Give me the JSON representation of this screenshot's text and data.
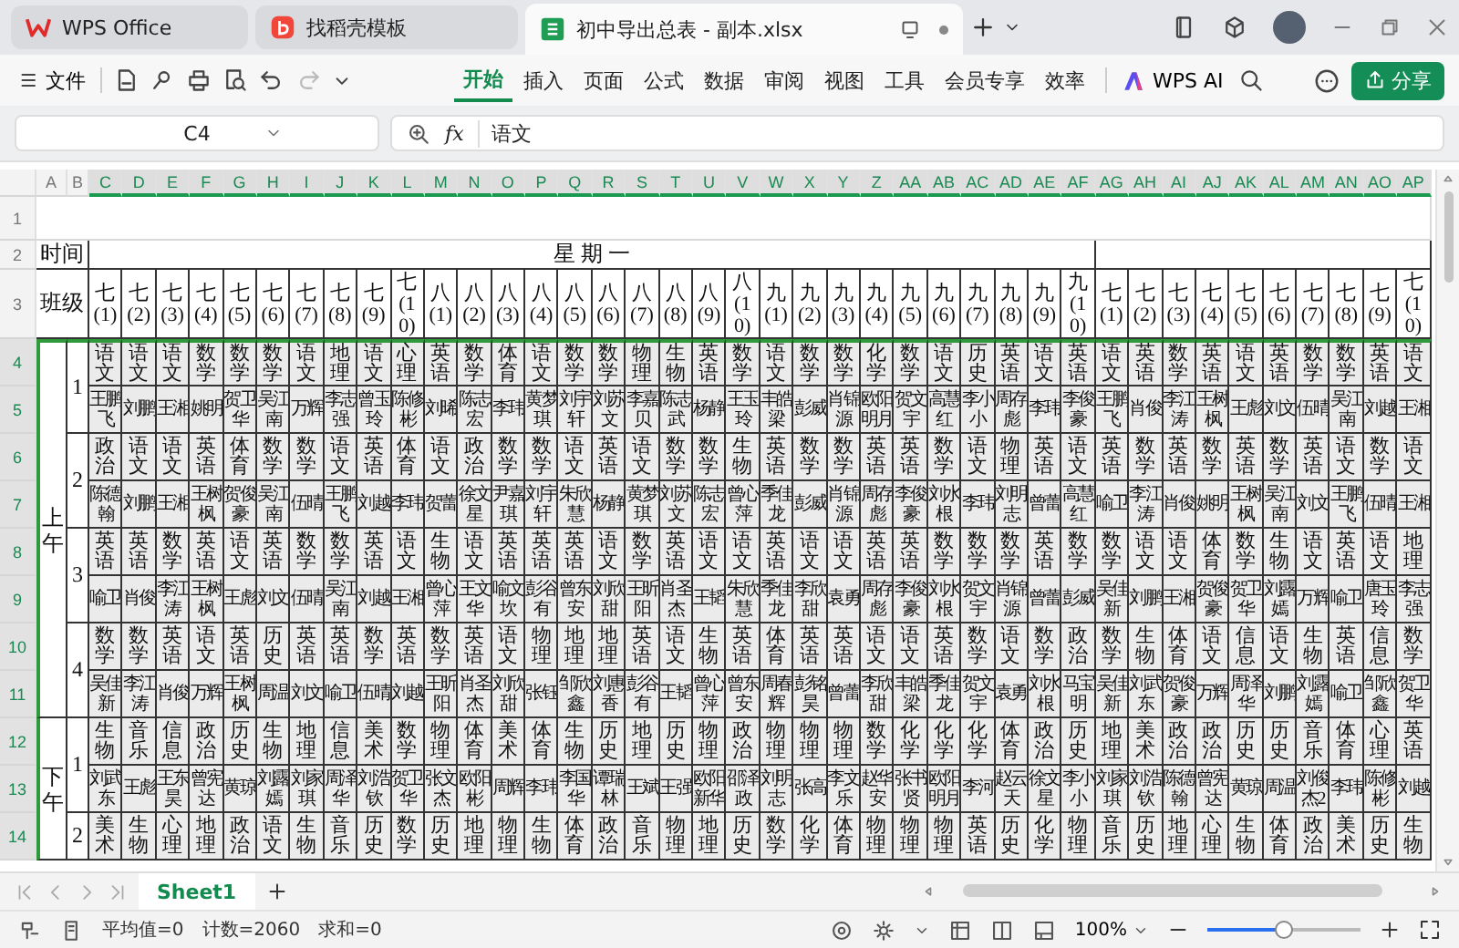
{
  "title_bar": {
    "tabs": [
      {
        "label": "WPS Office",
        "kind": "home",
        "selected": false
      },
      {
        "label": "找稻壳模板",
        "kind": "template",
        "selected": false
      },
      {
        "label": "初中导出总表 - 副本.xlsx",
        "kind": "document",
        "selected": true
      }
    ]
  },
  "toolbar": {
    "file_menu": "文件",
    "ribbon_tabs": [
      {
        "label": "开始",
        "selected": true
      },
      {
        "label": "插入",
        "selected": false
      },
      {
        "label": "页面",
        "selected": false
      },
      {
        "label": "公式",
        "selected": false
      },
      {
        "label": "数据",
        "selected": false
      },
      {
        "label": "审阅",
        "selected": false
      },
      {
        "label": "视图",
        "selected": false
      },
      {
        "label": "工具",
        "selected": false
      },
      {
        "label": "会员专享",
        "selected": false
      },
      {
        "label": "效率",
        "selected": false
      }
    ],
    "ai_label": "WPS AI",
    "share_label": "分享"
  },
  "formula_bar": {
    "cell_reference": "C4",
    "function_label": "fx",
    "value": "语文"
  },
  "sheet": {
    "column_headers": [
      "A",
      "B",
      "C",
      "D",
      "E",
      "F",
      "G",
      "H",
      "I",
      "J",
      "K",
      "L",
      "M",
      "N",
      "O",
      "P",
      "Q",
      "R",
      "S",
      "T",
      "U",
      "V",
      "W",
      "X",
      "Y",
      "Z",
      "AA",
      "AB",
      "AC",
      "AD",
      "AE",
      "AF",
      "AG",
      "AH",
      "AI",
      "AJ",
      "AK",
      "AL",
      "AM",
      "AN",
      "AO",
      "AP"
    ],
    "row_numbers": [
      "1",
      "2",
      "3",
      "4",
      "5",
      "6",
      "7",
      "8",
      "9",
      "10",
      "11",
      "12",
      "13",
      "14"
    ],
    "time_label": "时间",
    "day_label": "星 期 一",
    "class_label": "班级",
    "classes": [
      "七(1)",
      "七(2)",
      "七(3)",
      "七(4)",
      "七(5)",
      "七(6)",
      "七(7)",
      "七(8)",
      "七(9)",
      "七(10)",
      "八(1)",
      "八(2)",
      "八(3)",
      "八(4)",
      "八(5)",
      "八(6)",
      "八(7)",
      "八(8)",
      "八(9)",
      "八(10)",
      "九(1)",
      "九(2)",
      "九(3)",
      "九(4)",
      "九(5)",
      "九(6)",
      "九(7)",
      "九(8)",
      "九(9)",
      "九(10)",
      "七(1)",
      "七(2)",
      "七(3)",
      "七(4)",
      "七(5)",
      "七(6)",
      "七(7)",
      "七(8)",
      "七(9)",
      "七(10)"
    ],
    "sessions": [
      {
        "label": "上午",
        "periods": [
          {
            "label": "1",
            "subjects": [
              "语文",
              "语文",
              "语文",
              "数学",
              "数学",
              "数学",
              "语文",
              "地理",
              "语文",
              "心理",
              "英语",
              "数学",
              "体育",
              "语文",
              "数学",
              "数学",
              "物理",
              "生物",
              "英语",
              "数学",
              "语文",
              "数学",
              "数学",
              "化学",
              "数学",
              "语文",
              "历史",
              "英语",
              "语文",
              "英语",
              "语文",
              "英语",
              "数学",
              "英语",
              "语文",
              "英语",
              "数学",
              "数学",
              "英语",
              "语文"
            ],
            "teachers": [
              "王鹏飞",
              "刘鹏",
              "王湘",
              "姚明",
              "贺卫华",
              "吴江南",
              "万辉",
              "李志强",
              "曾玉玲",
              "陈修彬",
              "刘晞",
              "陈志宏",
              "李玮",
              "黄梦琪",
              "刘宇轩",
              "刘苏文",
              "李嘉贝",
              "陈志武",
              "杨静",
              "王玉玲",
              "丰皓梁",
              "彭威",
              "肖锦源",
              "欧阳明月",
              "贺文宇",
              "高慧红",
              "李小小",
              "周存彪",
              "李玮",
              "李俊豪",
              "王鹏飞",
              "肖俊",
              "李江涛",
              "王树枫",
              "王彪",
              "刘文",
              "伍晴",
              "吴江南",
              "刘越",
              "王湘"
            ]
          },
          {
            "label": "2",
            "subjects": [
              "政治",
              "语文",
              "语文",
              "英语",
              "体育",
              "数学",
              "数学",
              "语文",
              "英语",
              "体育",
              "语文",
              "政治",
              "数学",
              "数学",
              "语文",
              "英语",
              "语文",
              "数学",
              "数学",
              "生物",
              "英语",
              "数学",
              "数学",
              "英语",
              "英语",
              "数学",
              "语文",
              "物理",
              "英语",
              "语文",
              "英语",
              "数学",
              "英语",
              "数学",
              "英语",
              "数学",
              "英语",
              "语文",
              "数学",
              "语文"
            ],
            "teachers": [
              "陈德翰",
              "刘鹏",
              "王湘",
              "王树枫",
              "贺俊豪",
              "吴江南",
              "伍晴",
              "王鹏飞",
              "刘越",
              "李玮",
              "贺蕾",
              "徐文星",
              "尹嘉琪",
              "刘宇轩",
              "朱欣慧",
              "杨静",
              "黄梦琪",
              "刘苏文",
              "陈志宏",
              "曾心萍",
              "季佳龙",
              "彭威",
              "肖锦源",
              "周存彪",
              "李俊豪",
              "刘水根",
              "李玮",
              "刘明志",
              "曾蕾",
              "高慧红",
              "喻卫",
              "李江涛",
              "肖俊",
              "姚明",
              "王树枫",
              "吴江南",
              "刘文",
              "王鹏飞",
              "伍晴",
              "王湘"
            ]
          },
          {
            "label": "3",
            "subjects": [
              "英语",
              "英语",
              "数学",
              "英语",
              "语文",
              "英语",
              "数学",
              "数学",
              "英语",
              "语文",
              "生物",
              "语文",
              "英语",
              "英语",
              "英语",
              "语文",
              "数学",
              "英语",
              "语文",
              "语文",
              "英语",
              "语文",
              "语文",
              "英语",
              "英语",
              "数学",
              "数学",
              "数学",
              "英语",
              "数学",
              "数学",
              "语文",
              "语文",
              "体育",
              "数学",
              "生物",
              "语文",
              "英语",
              "语文",
              "地理"
            ],
            "teachers": [
              "喻卫",
              "肖俊",
              "李江涛",
              "王树枫",
              "王彪",
              "刘文",
              "伍晴",
              "吴江南",
              "刘越",
              "王湘",
              "曾心萍",
              "王文华",
              "喻文坎",
              "彭谷有",
              "曾东安",
              "刘欣甜",
              "王昕阳",
              "肖圣杰",
              "王韬",
              "朱欣慧",
              "季佳龙",
              "李欣甜",
              "袁勇",
              "周存彪",
              "李俊豪",
              "刘水根",
              "贺文宇",
              "肖锦源",
              "曾蕾",
              "彭威",
              "吴佳新",
              "刘鹏",
              "王湘",
              "贺俊豪",
              "贺卫华",
              "刘露嫣",
              "万辉",
              "喻卫",
              "唐玉玲",
              "李志强"
            ]
          },
          {
            "label": "4",
            "subjects": [
              "数学",
              "数学",
              "英语",
              "语文",
              "英语",
              "历史",
              "英语",
              "英语",
              "数学",
              "英语",
              "数学",
              "英语",
              "语文",
              "物理",
              "地理",
              "地理",
              "英语",
              "语文",
              "生物",
              "英语",
              "体育",
              "英语",
              "英语",
              "语文",
              "语文",
              "英语",
              "数学",
              "语文",
              "数学",
              "政治",
              "数学",
              "生物",
              "体育",
              "语文",
              "信息",
              "语文",
              "生物",
              "英语",
              "信息",
              "数学"
            ],
            "teachers": [
              "吴佳新",
              "李江涛",
              "肖俊",
              "万辉",
              "王树枫",
              "周温",
              "刘文",
              "喻卫",
              "伍晴",
              "刘越",
              "王昕阳",
              "肖圣杰",
              "刘欣甜",
              "张钰",
              "邹欣鑫",
              "刘惠香",
              "彭谷有",
              "王韬",
              "曾心萍",
              "曾东安",
              "周春辉",
              "彭铭昊",
              "曾蕾",
              "李欣甜",
              "丰皓梁",
              "季佳龙",
              "贺文宇",
              "袁勇",
              "刘水根",
              "马宝明",
              "吴佳新",
              "刘武东",
              "贺俊豪",
              "万辉",
              "周泽华",
              "刘鹏",
              "刘露嫣",
              "喻卫",
              "邹欣鑫",
              "贺卫华"
            ]
          }
        ]
      },
      {
        "label": "下午",
        "periods": [
          {
            "label": "1",
            "subjects": [
              "生物",
              "音乐",
              "信息",
              "政治",
              "历史",
              "生物",
              "地理",
              "信息",
              "美术",
              "数学",
              "物理",
              "体育",
              "美术",
              "体育",
              "生物",
              "历史",
              "地理",
              "历史",
              "物理",
              "政治",
              "物理",
              "物理",
              "物理",
              "数学",
              "化学",
              "化学",
              "化学",
              "体育",
              "政治",
              "历史",
              "地理",
              "美术",
              "政治",
              "政治",
              "历史",
              "历史",
              "音乐",
              "体育",
              "心理",
              "英语"
            ],
            "teachers": [
              "刘武东",
              "王彪",
              "王东昊",
              "曾宪达",
              "黄琼",
              "刘露嫣",
              "刘家琪",
              "周泽华",
              "刘浩钦",
              "贺卫华",
              "张文杰",
              "欧阳彬",
              "周辉",
              "李玮",
              "李国华",
              "谭瑞林",
              "王斌",
              "王强",
              "欧阳新华",
              "邵泽政",
              "刘明志",
              "张高",
              "李文乐",
              "赵华安",
              "张书贤",
              "欧阳明月",
              "李河",
              "赵云天",
              "徐文星",
              "李小小",
              "刘家琪",
              "刘浩钦",
              "陈德翰",
              "曾宪达",
              "黄琼",
              "周温",
              "刘俊杰2",
              "李玮",
              "陈修彬",
              "刘越"
            ]
          },
          {
            "label": "2",
            "subjects": [
              "美术",
              "生物",
              "心理",
              "地理",
              "政治",
              "语文",
              "生物",
              "音乐",
              "历史",
              "数学",
              "历史",
              "地理",
              "物理",
              "生物",
              "体育",
              "政治",
              "音乐",
              "物理",
              "地理",
              "历史",
              "数学",
              "化学",
              "体育",
              "物理",
              "物理",
              "物理",
              "英语",
              "历史",
              "化学",
              "物理",
              "音乐",
              "历史",
              "地理",
              "心理",
              "生物",
              "体育",
              "政治",
              "美术",
              "历史",
              "生物"
            ]
          }
        ]
      }
    ]
  },
  "sheet_tabs": [
    {
      "label": "Sheet1",
      "selected": true
    }
  ],
  "status_bar": {
    "average": "平均值=0",
    "count": "计数=2060",
    "sum": "求和=0",
    "zoom": "100%",
    "zoom_slider": {
      "level": 0.5
    }
  }
}
